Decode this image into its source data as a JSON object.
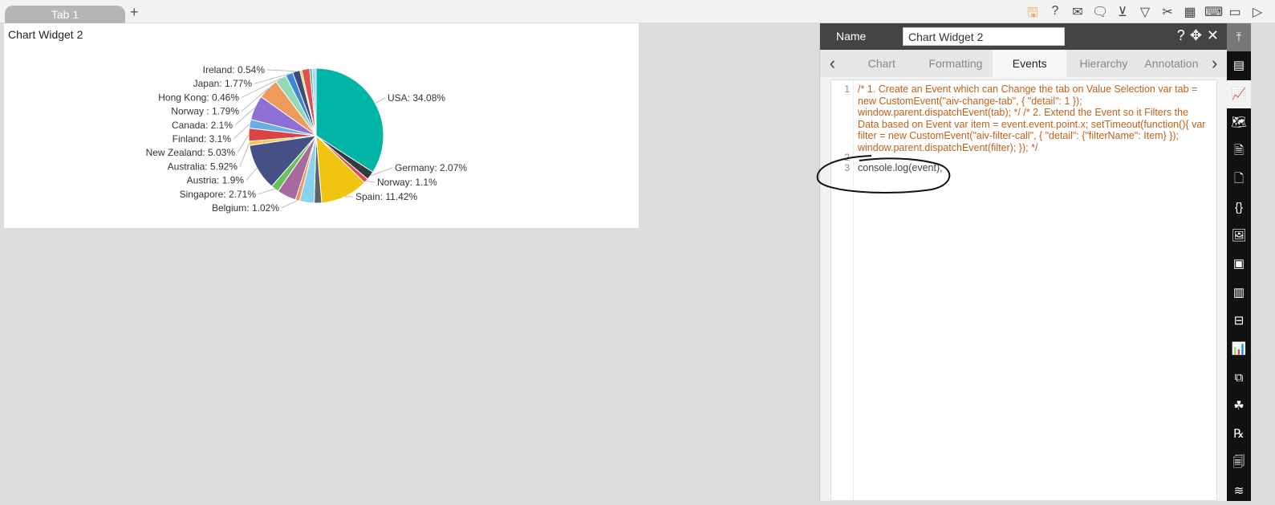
{
  "tabs": [
    {
      "label": "Tab 1"
    }
  ],
  "add_tab_label": "+",
  "toolbar_icons": [
    "save-icon",
    "help-icon",
    "mail-icon",
    "comment-icon",
    "clear-filter-icon",
    "filter-icon",
    "tools-icon",
    "table-icon",
    "embed-icon",
    "devices-icon",
    "play-icon"
  ],
  "toolbar_glyphs": [
    "🖫",
    "?",
    "✉",
    "🗨",
    "⊻",
    "▽",
    "✂",
    "▦",
    "⌨",
    "▭",
    "▷"
  ],
  "widget": {
    "title": "Chart Widget 2"
  },
  "chart_data": {
    "type": "pie",
    "slices": [
      {
        "label": "USA: 34.08%",
        "value": 34.08,
        "color": "#00b5a5"
      },
      {
        "label": "Germany: 2.07%",
        "value": 2.07,
        "color": "#2f3b3e"
      },
      {
        "label": "Norway: 1.1%",
        "value": 1.1,
        "color": "#e84b4b"
      },
      {
        "label": "Spain: 11.42%",
        "value": 11.42,
        "color": "#f1c40f"
      },
      {
        "label": null,
        "value": 1.8,
        "color": "#5b6766"
      },
      {
        "label": null,
        "value": 3.5,
        "color": "#87d3ec"
      },
      {
        "label": "Belgium: 1.02%",
        "value": 1.02,
        "color": "#f39057"
      },
      {
        "label": null,
        "value": 4.6,
        "color": "#a66a9c"
      },
      {
        "label": "Singapore: 2.71%",
        "value": 1.9,
        "color": "#6cbf5a"
      },
      {
        "label": "Austria: 1.9%",
        "value": 11.19,
        "color": "#455185"
      },
      {
        "label": "Australia: 5.92%",
        "value": 1.0,
        "color": "#f1c84b"
      },
      {
        "label": "New Zealand: 5.03%",
        "value": 3.1,
        "color": "#d84343"
      },
      {
        "label": "Finland: 3.1%",
        "value": 2.1,
        "color": "#6aaee6"
      },
      {
        "label": "Canada: 2.1%",
        "value": 5.92,
        "color": "#8e6fd6"
      },
      {
        "label": "Norway : 1.79%",
        "value": 5.03,
        "color": "#ef9a5c"
      },
      {
        "label": "Hong Kong: 0.46%",
        "value": 2.71,
        "color": "#92d9b4"
      },
      {
        "label": "Japan: 1.77%",
        "value": 1.79,
        "color": "#3f86d8"
      },
      {
        "label": "Ireland: 0.54%",
        "value": 1.77,
        "color": "#3c4b78"
      },
      {
        "label": null,
        "value": 0.46,
        "color": "#f1c40f"
      },
      {
        "label": null,
        "value": 1.9,
        "color": "#e05050"
      },
      {
        "label": null,
        "value": 0.54,
        "color": "#3fae7c"
      },
      {
        "label": null,
        "value": 1.0,
        "color": "#a6d6f5"
      }
    ]
  },
  "panel": {
    "name_label": "Name",
    "name_value": "Chart Widget 2",
    "tabs": [
      "Chart",
      "Formatting",
      "Events",
      "Hierarchy",
      "Annotation"
    ],
    "active_tab": "Events",
    "code_lines": [
      "1",
      "2",
      "3"
    ],
    "code_comment": "/* 1. Create an Event which can Change the tab on Value Selection var tab = new CustomEvent(\"aiv-change-tab\", {    \"detail\": 1 }); window.parent.dispatchEvent(tab);  */ /* 2. Extend the Event so it Filters the Data based on Event var item = event.event.point.x; setTimeout(function(){ var filter = new CustomEvent(\"aiv-filter-call\", {    \"detail\": {\"filterName\": Item}  }); window.parent.dispatchEvent(filter); }); */",
    "code_line3": "console.log(event);"
  },
  "sidebar_glyphs": [
    "⤒",
    "▤",
    "📈",
    "🗺",
    "🗎",
    "🗋",
    "{}",
    "🖼",
    "▣",
    "▥",
    "⊟",
    "📊",
    "⧉",
    "☘",
    "℞",
    "🗐",
    "≋"
  ]
}
